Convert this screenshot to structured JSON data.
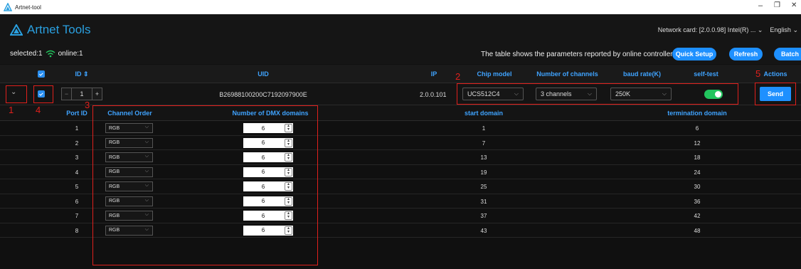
{
  "window": {
    "title": "Artnet-tool",
    "minimize": "–",
    "maximize": "❐",
    "close": "✕"
  },
  "brand": {
    "name": "Artnet Tools"
  },
  "header": {
    "network_card": "Network card: [2.0.0.98] Intel(R) ...",
    "language": "English"
  },
  "status": {
    "selected": "selected:1",
    "online": "online:1"
  },
  "notice": "The table shows the parameters reported by online controller.",
  "buttons": {
    "quick_setup": "Quick Setup",
    "refresh": "Refresh",
    "batch": "Batch",
    "send": "Send"
  },
  "table_headers": {
    "id": "ID",
    "uid": "UID",
    "ip": "IP",
    "chip_model": "Chip model",
    "channels": "Number of channels",
    "baud": "baud rate(K)",
    "self_test": "self-test",
    "actions": "Actions"
  },
  "device": {
    "id": "1",
    "uid": "B26988100200C7192097900E",
    "ip": "2.0.0.101",
    "chip_model": "UCS512C4",
    "channels": "3 channels",
    "baud": "250K",
    "self_test": true
  },
  "sub_headers": {
    "port_id": "Port ID",
    "channel_order": "Channel Order",
    "dmx_domains": "Number of DMX domains",
    "start_domain": "start domain",
    "termination_domain": "termination domain"
  },
  "ports": [
    {
      "port": "1",
      "order": "RGB",
      "domains": "6",
      "start": "1",
      "end": "6"
    },
    {
      "port": "2",
      "order": "RGB",
      "domains": "6",
      "start": "7",
      "end": "12"
    },
    {
      "port": "3",
      "order": "RGB",
      "domains": "6",
      "start": "13",
      "end": "18"
    },
    {
      "port": "4",
      "order": "RGB",
      "domains": "6",
      "start": "19",
      "end": "24"
    },
    {
      "port": "5",
      "order": "RGB",
      "domains": "6",
      "start": "25",
      "end": "30"
    },
    {
      "port": "6",
      "order": "RGB",
      "domains": "6",
      "start": "31",
      "end": "36"
    },
    {
      "port": "7",
      "order": "RGB",
      "domains": "6",
      "start": "37",
      "end": "42"
    },
    {
      "port": "8",
      "order": "RGB",
      "domains": "6",
      "start": "43",
      "end": "48"
    }
  ],
  "annotations": {
    "a1": "1",
    "a2": "2",
    "a3": "3",
    "a4": "4",
    "a5": "5"
  },
  "colors": {
    "accent": "#1e90ff",
    "header_text": "#3fa3ff",
    "annotation": "#e0201c",
    "toggle_on": "#22c55e"
  }
}
